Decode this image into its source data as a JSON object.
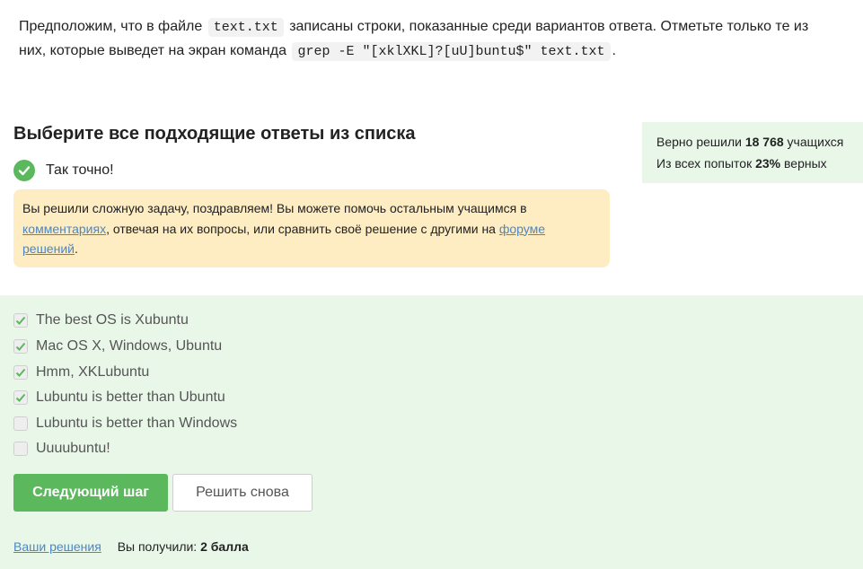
{
  "question": {
    "part1": "Предположим, что в файле",
    "file_code": "text.txt",
    "part2": "записаны строки, показанные среди вариантов ответа. Отметьте только те из них, которые выведет на экран команда",
    "command_code": "grep -E \"[xklXKL]?[uU]buntu$\" text.txt",
    "part3": "."
  },
  "task_title": "Выберите все подходящие ответы из списка",
  "result": {
    "text": "Так точно!",
    "icon": "check-circle-icon",
    "color": "#5cb85c"
  },
  "notice": {
    "text1": "Вы решили сложную задачу, поздравляем! Вы можете помочь остальным учащимся в",
    "link1": "комментариях",
    "text2": ", отвечая на их вопросы, или сравнить своё решение с другими на",
    "link2": "форуме решений",
    "text3": "."
  },
  "stats": {
    "solved_prefix": "Верно решили",
    "solved_count": "18 768",
    "solved_suffix": "учащихся",
    "attempts_prefix": "Из всех попыток",
    "attempts_percent": "23%",
    "attempts_suffix": "верных"
  },
  "options": [
    {
      "label": "The best OS is Xubuntu",
      "checked": true
    },
    {
      "label": "Mac OS X, Windows, Ubuntu",
      "checked": true
    },
    {
      "label": "Hmm, XKLubuntu",
      "checked": true
    },
    {
      "label": "Lubuntu is better than Ubuntu",
      "checked": true
    },
    {
      "label": "Lubuntu is better than Windows",
      "checked": false
    },
    {
      "label": "Uuuubuntu!",
      "checked": false
    }
  ],
  "buttons": {
    "next": "Следующий шаг",
    "retry": "Решить снова"
  },
  "footer": {
    "your_solutions": "Ваши решения",
    "score_prefix": "Вы получили:",
    "score": "2 балла"
  },
  "colors": {
    "accent": "#5cb85c",
    "answers_bg": "#e9f7e9",
    "notice_bg": "#feecc3",
    "link": "#4a87c5"
  }
}
